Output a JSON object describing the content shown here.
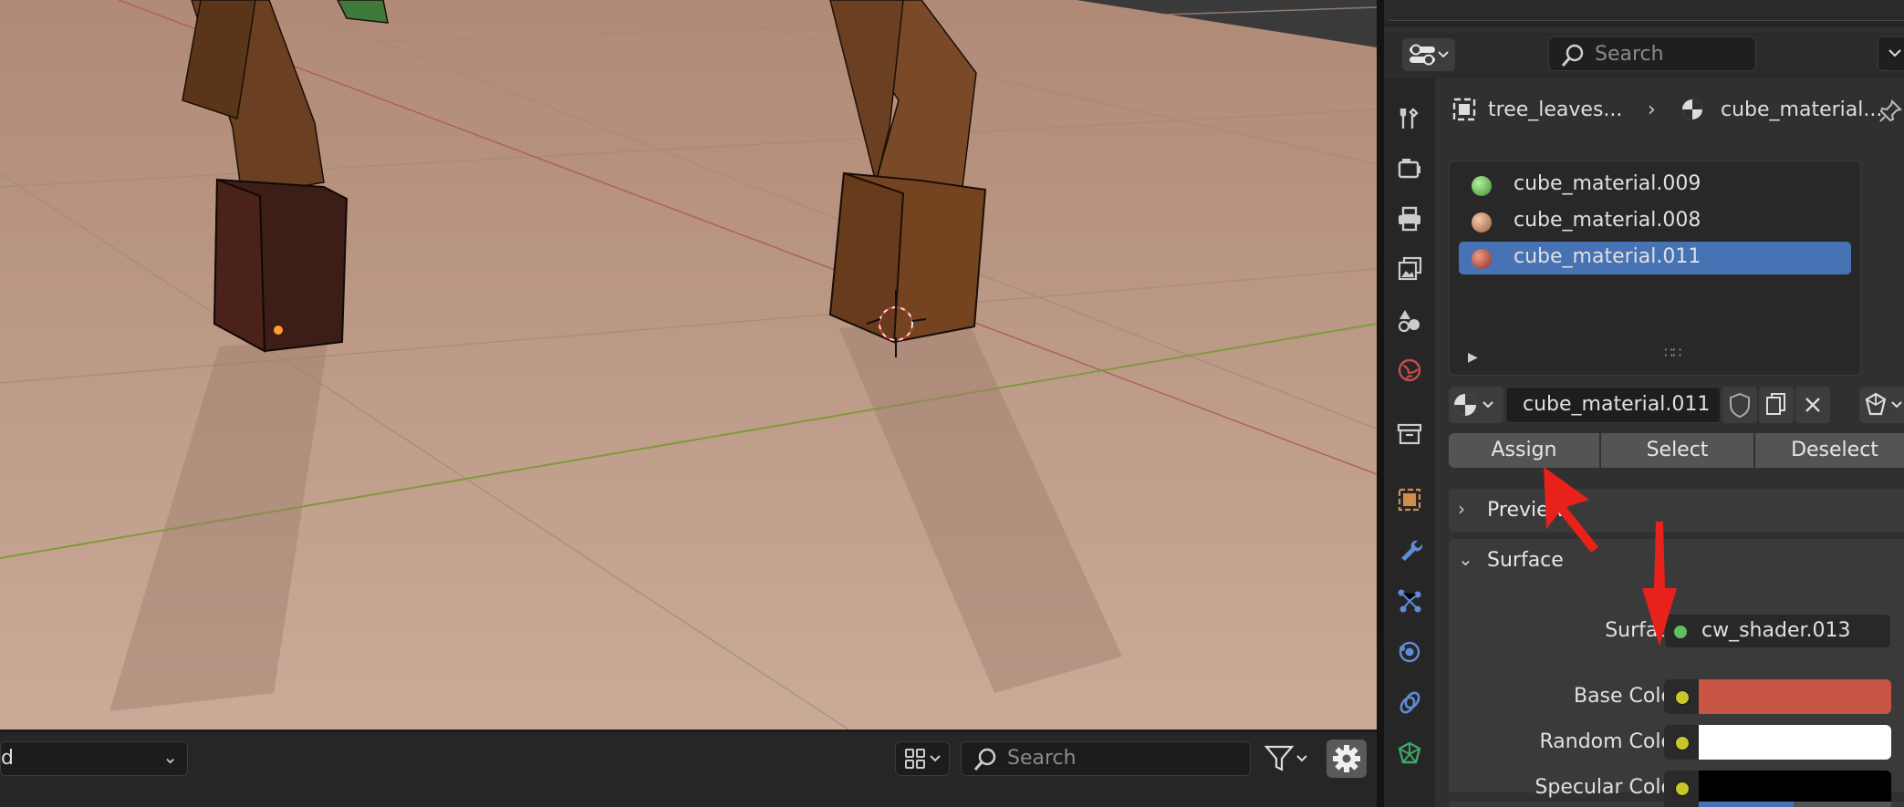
{
  "viewport": {
    "mode_dropdown": "d",
    "search_placeholder": "Search"
  },
  "properties": {
    "search_placeholder": "Search",
    "breadcrumb": {
      "object": "tree_leaves...",
      "material": "cube_material..."
    },
    "material_slots": [
      {
        "name": "cube_material.009",
        "color": "#6fbf4f",
        "selected": false
      },
      {
        "name": "cube_material.008",
        "color": "#c98b60",
        "selected": false
      },
      {
        "name": "cube_material.011",
        "color": "#b54a38",
        "selected": true
      }
    ],
    "active_material": "cube_material.011",
    "actions": {
      "assign": "Assign",
      "select": "Select",
      "deselect": "Deselect"
    },
    "panels": {
      "preview": "Preview",
      "surface": "Surface"
    },
    "surface": {
      "surface_label": "Surface",
      "surface_value": "cw_shader.013",
      "base_color_label": "Base Color",
      "base_color": "#c85443",
      "random_color_label": "Random Color",
      "random_color": "#ffffff",
      "specular_color_label": "Specular Color",
      "specular_color": "#000000"
    }
  },
  "colors": {
    "accent": "#4772b3",
    "annotation_arrow": "#e8211b"
  }
}
